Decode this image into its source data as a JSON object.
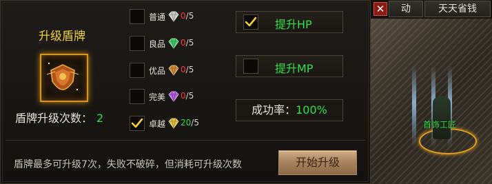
{
  "item": {
    "title": "升级盾牌",
    "icon": "shield-icon"
  },
  "upgrade": {
    "label": "盾牌升级次数：",
    "value": "2"
  },
  "materials": [
    {
      "name": "普通",
      "have": "0",
      "sep": "/",
      "need": "5",
      "checked": false,
      "gem_color": "#c8c8c8"
    },
    {
      "name": "良品",
      "have": "0",
      "sep": "/",
      "need": "5",
      "checked": false,
      "gem_color": "#46c86a"
    },
    {
      "name": "优品",
      "have": "0",
      "sep": "/",
      "need": "5",
      "checked": false,
      "gem_color": "#d08a3a"
    },
    {
      "name": "完美",
      "have": "0",
      "sep": "/",
      "need": "5",
      "checked": false,
      "gem_color": "#b060e0"
    },
    {
      "name": "卓越",
      "have": "20",
      "sep": "/",
      "need": "5",
      "checked": true,
      "gem_color": "#e0c040"
    }
  ],
  "options": {
    "hp": {
      "label": "提升HP",
      "checked": true
    },
    "mp": {
      "label": "提升MP",
      "checked": false
    }
  },
  "rate": {
    "label": "成功率：",
    "value": "100%"
  },
  "notice": "盾牌最多可升级7次，失败不破碎，但消耗可升级次数",
  "start_button": "开始升级",
  "game": {
    "close": "✕",
    "tab1": "动",
    "tab2": "天天省钱",
    "npc_name": "首饰工匠"
  },
  "colors": {
    "accent_green": "#32e04a",
    "title_gold": "#f0d23a",
    "count_red": "#ff3a3a"
  }
}
